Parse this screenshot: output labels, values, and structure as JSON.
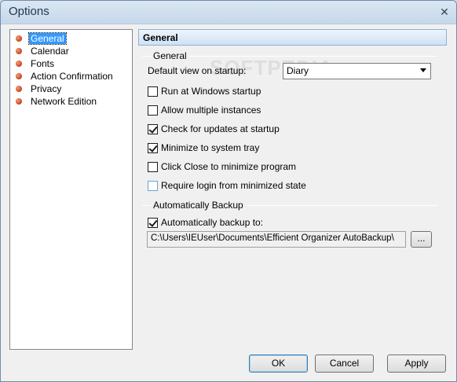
{
  "window": {
    "title": "Options",
    "close_glyph": "✕"
  },
  "tree": {
    "items": [
      {
        "label": "General",
        "selected": true
      },
      {
        "label": "Calendar"
      },
      {
        "label": "Fonts"
      },
      {
        "label": "Action Confirmation"
      },
      {
        "label": "Privacy"
      },
      {
        "label": "Network Edition"
      }
    ]
  },
  "page": {
    "header": "General",
    "general_group": "General",
    "default_view_label": "Default view on startup:",
    "default_view_value": "Diary",
    "options": [
      {
        "label": "Run at Windows startup",
        "checked": false
      },
      {
        "label": "Allow multiple instances",
        "checked": false
      },
      {
        "label": "Check for updates at startup",
        "checked": true
      },
      {
        "label": "Minimize to system tray",
        "checked": true
      },
      {
        "label": "Click Close to minimize program",
        "checked": false
      },
      {
        "label": "Require login from minimized state",
        "checked": false
      }
    ],
    "backup_group": "Automatically Backup",
    "backup_checkbox": {
      "label": "Automatically backup to:",
      "checked": true
    },
    "backup_path": "C:\\Users\\IEUser\\Documents\\Efficient Organizer AutoBackup\\",
    "browse_label": "..."
  },
  "buttons": {
    "ok": "OK",
    "cancel": "Cancel",
    "apply": "Apply"
  },
  "watermark": "SOFTPEDIA",
  "colors": {
    "selection": "#3399ff",
    "header_border": "#8db2d9",
    "bullet": "#c8401e"
  }
}
